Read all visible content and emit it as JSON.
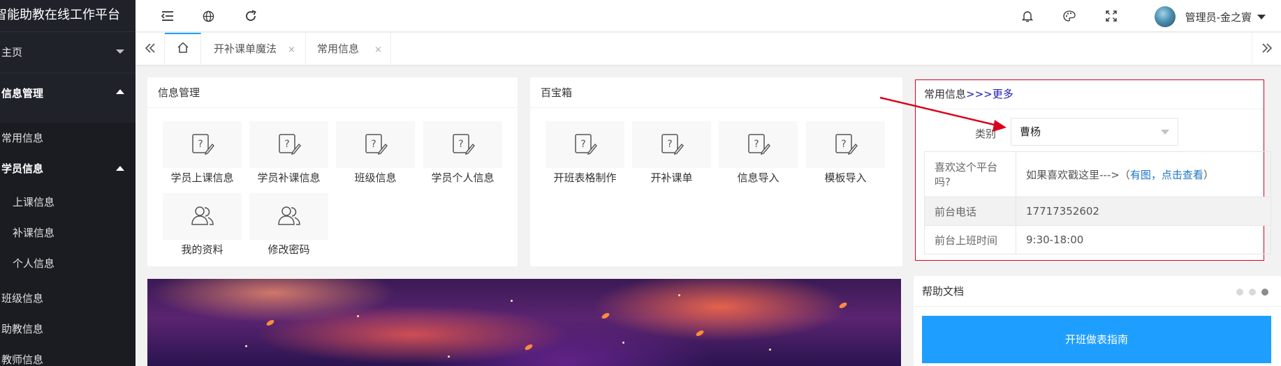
{
  "app": {
    "title": "智能助教在线工作平台"
  },
  "sidebar": {
    "items": [
      {
        "label": "主页"
      },
      {
        "label": "信息管理"
      },
      {
        "label": "常用信息"
      },
      {
        "label": "学员信息"
      },
      {
        "label": "上课信息"
      },
      {
        "label": "补课信息"
      },
      {
        "label": "个人信息"
      },
      {
        "label": "班级信息"
      },
      {
        "label": "助教信息"
      },
      {
        "label": "教师信息"
      }
    ]
  },
  "header": {
    "icons": [
      "menu-collapse-icon",
      "globe-icon",
      "refresh-icon",
      "bell-icon",
      "palette-icon",
      "fullscreen-icon"
    ],
    "user_name": "管理员-金之賨"
  },
  "tabs": {
    "items": [
      {
        "label": "开补课单魔法",
        "close": "×"
      },
      {
        "label": "常用信息",
        "close": "×"
      }
    ]
  },
  "info_mgmt": {
    "title": "信息管理",
    "tiles": [
      {
        "label": "学员上课信息",
        "icon": "edit-doc-icon"
      },
      {
        "label": "学员补课信息",
        "icon": "edit-doc-icon"
      },
      {
        "label": "班级信息",
        "icon": "edit-doc-icon"
      },
      {
        "label": "学员个人信息",
        "icon": "edit-doc-icon"
      },
      {
        "label": "我的资料",
        "icon": "users-icon"
      },
      {
        "label": "修改密码",
        "icon": "users-icon"
      }
    ]
  },
  "toolbox": {
    "title": "百宝箱",
    "tiles": [
      {
        "label": "开班表格制作",
        "icon": "edit-doc-icon"
      },
      {
        "label": "开补课单",
        "icon": "edit-doc-icon"
      },
      {
        "label": "信息导入",
        "icon": "edit-doc-icon"
      },
      {
        "label": "模板导入",
        "icon": "edit-doc-icon"
      }
    ]
  },
  "common_info": {
    "title": "常用信息",
    "more_prefix": ">>>",
    "more_label": "更多",
    "category_label": "类别",
    "category_value": "曹杨",
    "rows": [
      {
        "key": "喜欢这个平台吗?",
        "value_prefix": "如果喜欢戳这里--->（",
        "value_link": "有图，点击查看",
        "value_suffix": "）"
      },
      {
        "key": "前台电话",
        "value": "17717352602"
      },
      {
        "key": "前台上班时间",
        "value": "9:30-18:00"
      }
    ]
  },
  "help": {
    "title": "帮助文档",
    "button_label": "开班做表指南"
  },
  "colors": {
    "sidebar_bg": "#20222a",
    "accent_blue": "#1e9fff",
    "highlight_red": "#d9001b"
  }
}
